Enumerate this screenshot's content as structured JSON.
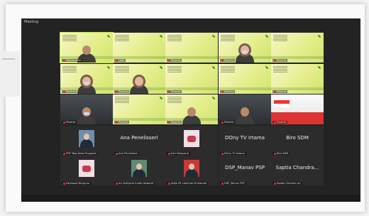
{
  "window": {
    "title": "Meeting"
  },
  "grid": {
    "row1": [
      {
        "type": "poster",
        "caption": "Narasumber",
        "highlight": true,
        "person": "plain"
      },
      {
        "type": "poster",
        "caption": "Host"
      },
      {
        "type": "poster",
        "caption": "Peserta"
      },
      {
        "type": "poster",
        "caption": "Peserta",
        "person": "hijab mask"
      },
      {
        "type": "poster",
        "caption": "Peserta"
      }
    ],
    "row2": [
      {
        "type": "poster",
        "caption": "Peserta",
        "person": "hijab mask"
      },
      {
        "type": "poster",
        "caption": "Peserta",
        "person": "hijab"
      },
      {
        "type": "poster",
        "caption": "Peserta"
      },
      {
        "type": "poster",
        "caption": "Peserta"
      },
      {
        "type": "poster",
        "caption": "Peserta"
      }
    ],
    "row3": [
      {
        "type": "real",
        "caption": "Peserta",
        "person": "mask"
      },
      {
        "type": "poster",
        "caption": "Peserta"
      },
      {
        "type": "poster",
        "caption": "Peserta",
        "person": "plain"
      },
      {
        "type": "real",
        "caption": "Peserta",
        "person": "plain"
      },
      {
        "type": "flag",
        "caption": "Peserta"
      }
    ],
    "row4": [
      {
        "type": "avatar",
        "avatar": "blue",
        "caption": "PMP Bag Data Pengolah"
      },
      {
        "type": "name",
        "name": "Ana Penelisseri",
        "caption": "Ana Penelisseri"
      },
      {
        "type": "avatar",
        "avatar": "pink",
        "caption": "Dwi Hidayanti"
      },
      {
        "type": "name",
        "name": "DOny TV Irtama",
        "caption": "DOny TV Irtama"
      },
      {
        "type": "name",
        "name": "Biro SDM",
        "caption": "Biro SDM"
      }
    ],
    "row5": [
      {
        "type": "avatar",
        "avatar": "pink",
        "caption": "Dwinopal Ningrum"
      },
      {
        "type": "avatar",
        "avatar": "green",
        "caption": "Ari Setiyanti Indah Dewanti"
      },
      {
        "type": "avatar",
        "avatar": "red",
        "caption": "Adjie PK Lamindo Muhamad"
      },
      {
        "type": "name",
        "name": "DSP_Manav PSP",
        "caption": "DSP_Manav PSP"
      },
      {
        "type": "name",
        "name": "Saptia Chandra...",
        "caption": "Saptia Chandra Ari"
      }
    ]
  }
}
